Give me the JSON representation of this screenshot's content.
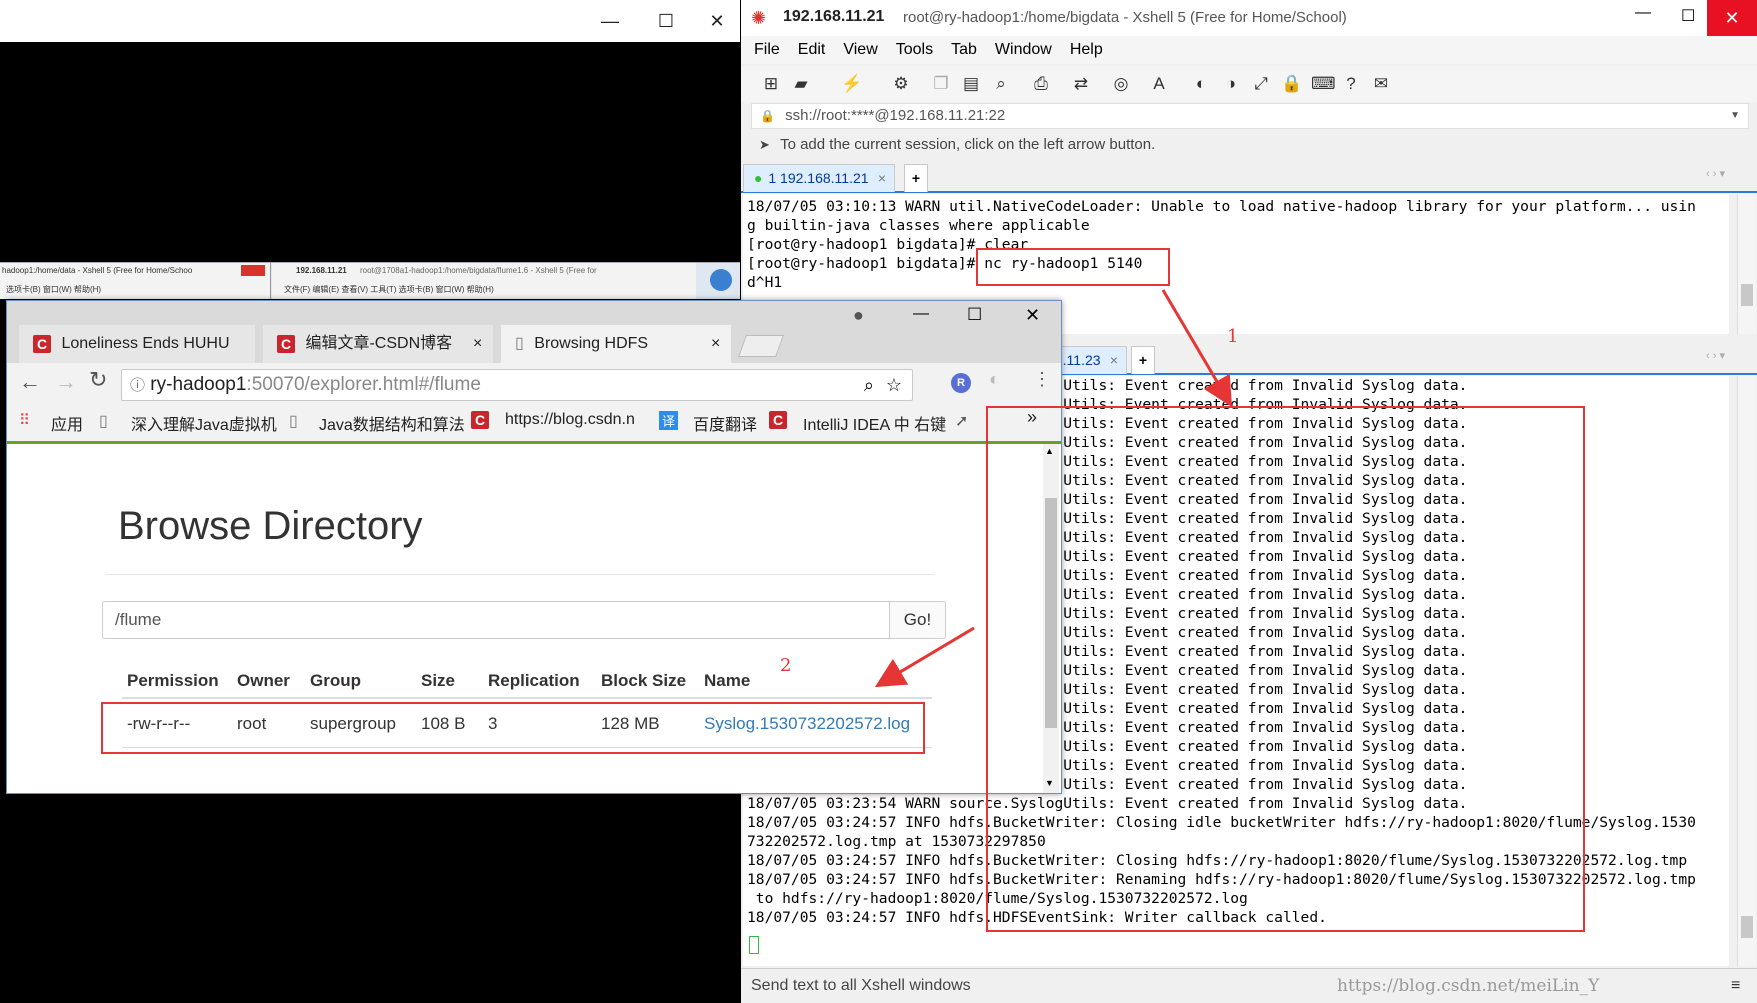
{
  "black_window": {
    "minimize": "—",
    "maximize": "☐",
    "close": "✕"
  },
  "xshell": {
    "ip": "192.168.11.21",
    "title": "root@ry-hadoop1:/home/bigdata - Xshell 5 (Free for Home/School)",
    "menu": [
      "File",
      "Edit",
      "View",
      "Tools",
      "Tab",
      "Window",
      "Help"
    ],
    "address": "ssh://root:****@192.168.11.21:22",
    "hint": "To add the current session, click on the left arrow button.",
    "tab1": {
      "label": "1 192.168.11.21",
      "close": "×",
      "add": "+"
    },
    "tab3": {
      "label": "3 192.168.11.23",
      "close": "×",
      "add": "+"
    },
    "term1_lines": [
      "18/07/05 03:10:13 WARN util.NativeCodeLoader: Unable to load native-hadoop library for your platform... usin",
      "g builtin-java classes where applicable",
      "[root@ry-hadoop1 bigdata]# clear",
      "[root@ry-hadoop1 bigdata]# nc ry-hadoop1 5140",
      "d^H1"
    ],
    "term2_lines": [
      "18/07/05 03:23:54 WARN source.SyslogUtils: Event created from Invalid Syslog data.",
      "18/07/05 03:23:54 WARN source.SyslogUtils: Event created from Invalid Syslog data.",
      "18/07/05 03:23:54 WARN source.SyslogUtils: Event created from Invalid Syslog data.",
      "18/07/05 03:23:54 WARN source.SyslogUtils: Event created from Invalid Syslog data.",
      "18/07/05 03:23:54 WARN source.SyslogUtils: Event created from Invalid Syslog data.",
      "18/07/05 03:23:54 WARN source.SyslogUtils: Event created from Invalid Syslog data.",
      "18/07/05 03:23:54 WARN source.SyslogUtils: Event created from Invalid Syslog data.",
      "18/07/05 03:23:54 WARN source.SyslogUtils: Event created from Invalid Syslog data.",
      "18/07/05 03:23:54 WARN source.SyslogUtils: Event created from Invalid Syslog data.",
      "18/07/05 03:23:54 WARN source.SyslogUtils: Event created from Invalid Syslog data.",
      "18/07/05 03:23:54 WARN source.SyslogUtils: Event created from Invalid Syslog data.",
      "18/07/05 03:23:54 WARN source.SyslogUtils: Event created from Invalid Syslog data.",
      "18/07/05 03:23:54 WARN source.SyslogUtils: Event created from Invalid Syslog data.",
      "18/07/05 03:23:54 WARN source.SyslogUtils: Event created from Invalid Syslog data.",
      "18/07/05 03:23:54 WARN source.SyslogUtils: Event created from Invalid Syslog data.",
      "18/07/05 03:23:54 WARN source.SyslogUtils: Event created from Invalid Syslog data.",
      "18/07/05 03:23:54 WARN source.SyslogUtils: Event created from Invalid Syslog data.",
      "18/07/05 03:23:54 WARN source.SyslogUtils: Event created from Invalid Syslog data.",
      "18/07/05 03:23:54 WARN source.SyslogUtils: Event created from Invalid Syslog data.",
      "18/07/05 03:23:54 WARN source.SyslogUtils: Event created from Invalid Syslog data.",
      "18/07/05 03:23:54 WARN source.SyslogUtils: Event created from Invalid Syslog data.",
      "18/07/05 03:23:53 WARN source.SyslogUtils: Event created from Invalid Syslog data.",
      "18/07/05 03:23:54 WARN source.SyslogUtils: Event created from Invalid Syslog data.",
      "18/07/05 03:24:57 INFO hdfs.BucketWriter: Closing idle bucketWriter hdfs://ry-hadoop1:8020/flume/Syslog.1530",
      "732202572.log.tmp at 1530732297850",
      "18/07/05 03:24:57 INFO hdfs.BucketWriter: Closing hdfs://ry-hadoop1:8020/flume/Syslog.1530732202572.log.tmp",
      "18/07/05 03:24:57 INFO hdfs.BucketWriter: Renaming hdfs://ry-hadoop1:8020/flume/Syslog.1530732202572.log.tmp",
      " to hdfs://ry-hadoop1:8020/flume/Syslog.1530732202572.log",
      "18/07/05 03:24:57 INFO hdfs.HDFSEventSink: Writer callback called."
    ],
    "status": "Send text to all Xshell windows",
    "watermark": "https://blog.csdn.net/meiLin_Y"
  },
  "preview_strip": {
    "left_title": "hadoop1:/home/data - Xshell 5 (Free for Home/Schoo",
    "left_menu": "选项卡(B)    窗口(W)    帮助(H)",
    "right_ip": "192.168.11.21",
    "right_title": "root@1708a1-hadoop1:/home/bigdata/flume1.6 - Xshell 5 (Free for ",
    "right_menu": "文件(F)   编辑(E)   查看(V)   工具(T)   选项卡(B)   窗口(W)   帮助(H)"
  },
  "chrome": {
    "tabs": [
      "Loneliness Ends HUHU",
      "编辑文章-CSDN博客",
      "Browsing HDFS"
    ],
    "tab_close": "×",
    "url_host": "ry-hadoop1",
    "url_rest": ":50070/explorer.html#/flume",
    "bookmarks": [
      "应用",
      "深入理解Java虚拟机",
      "Java数据结构和算法",
      "https://blog.csdn.n",
      "百度翻译",
      "IntelliJ IDEA 中 右键"
    ],
    "bookmark_more": "»",
    "page_title": "Browse Directory",
    "path_value": "/flume",
    "go_button": "Go!",
    "columns": [
      "Permission",
      "Owner",
      "Group",
      "Size",
      "Replication",
      "Block Size",
      "Name"
    ],
    "row": [
      "-rw-r--r--",
      "root",
      "supergroup",
      "108 B",
      "3",
      "128 MB",
      "Syslog.1530732202572.log"
    ]
  },
  "annotations": {
    "one": "1",
    "two": "2",
    "accent": "#e53535"
  }
}
